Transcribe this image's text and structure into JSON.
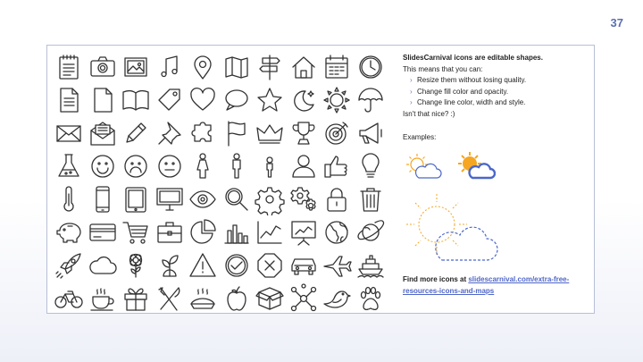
{
  "page_number": "37",
  "info": {
    "title": "SlidesCarnival icons are editable shapes.",
    "intro": "This means that you can:",
    "bullets": [
      "Resize them without losing quality.",
      "Change fill color and opacity.",
      "Change line color, width and style."
    ],
    "closing": "Isn't that nice? :)"
  },
  "examples_label": "Examples:",
  "footer": {
    "prefix": "Find more icons at ",
    "link_text": "slidescarnival.com/extra-free-resources-icons-and-maps"
  },
  "colors": {
    "accent": "#5a6fb0",
    "link": "#4f66c7",
    "icon_stroke": "#333333",
    "sun_orange": "#f5a623",
    "cloud_blue": "#4a67c9"
  },
  "icons": [
    [
      "notepad-icon",
      "camera-icon",
      "picture-icon",
      "music-note-icon",
      "location-pin-icon",
      "map-icon",
      "signpost-icon",
      "home-icon",
      "calendar-icon",
      "clock-icon"
    ],
    [
      "document-icon",
      "blank-page-icon",
      "open-book-icon",
      "tag-icon",
      "heart-icon",
      "speech-bubble-icon",
      "star-icon",
      "moon-stars-icon",
      "sun-icon",
      "umbrella-icon"
    ],
    [
      "envelope-icon",
      "open-envelope-icon",
      "pencil-icon",
      "pushpin-icon",
      "puzzle-icon",
      "flag-icon",
      "crown-icon",
      "trophy-icon",
      "target-icon",
      "megaphone-icon"
    ],
    [
      "flask-icon",
      "happy-face-icon",
      "sad-face-icon",
      "neutral-face-icon",
      "woman-icon",
      "man-icon",
      "child-icon",
      "user-icon",
      "thumbs-up-icon",
      "lightbulb-icon"
    ],
    [
      "thermometer-icon",
      "smartphone-icon",
      "tablet-icon",
      "monitor-icon",
      "eye-icon",
      "magnifier-icon",
      "gear-icon",
      "gears-icon",
      "padlock-icon",
      "trash-icon"
    ],
    [
      "piggy-bank-icon",
      "credit-card-icon",
      "shopping-cart-icon",
      "briefcase-icon",
      "pie-chart-icon",
      "bar-chart-icon",
      "line-chart-icon",
      "presentation-icon",
      "globe-icon",
      "planet-icon"
    ],
    [
      "rocket-icon",
      "cloud-icon",
      "flower-icon",
      "sprout-icon",
      "warning-icon",
      "check-circle-icon",
      "cancel-circle-icon",
      "car-icon",
      "airplane-icon",
      "ship-icon"
    ],
    [
      "bicycle-icon",
      "coffee-cup-icon",
      "gift-icon",
      "fork-knife-icon",
      "pie-icon",
      "apple-icon",
      "box-icon",
      "network-icon",
      "bird-icon",
      "paw-icon"
    ]
  ]
}
